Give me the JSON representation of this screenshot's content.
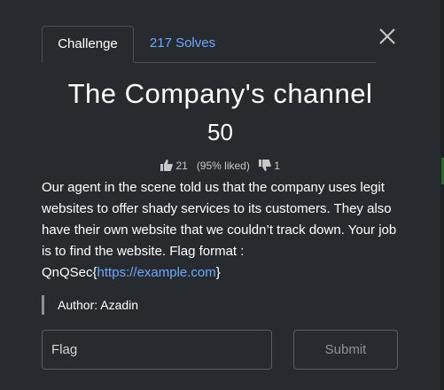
{
  "tabs": {
    "challenge_label": "Challenge",
    "solves_label": "217 Solves"
  },
  "challenge": {
    "title": "The Company's channel",
    "points": "50",
    "likes": "21",
    "liked_percent": "(95% liked)",
    "dislikes": "1",
    "description_text": "Our agent in the scene told us that the company uses legit websites to offer shady services to its customers. They also have their own website that we couldn’t track down. Your job is to find the website. Flag format : QnQSec{",
    "description_link": "https://example.com",
    "description_suffix": "}",
    "author": "Author: Azadin"
  },
  "form": {
    "flag_placeholder": "Flag",
    "submit_label": "Submit"
  },
  "icons": {
    "close": "close-icon",
    "thumbs_up": "thumbs-up-icon",
    "thumbs_down": "thumbs-down-icon"
  },
  "colors": {
    "background": "#272b30",
    "link": "#6ea8fe",
    "text": "#ffffff"
  }
}
